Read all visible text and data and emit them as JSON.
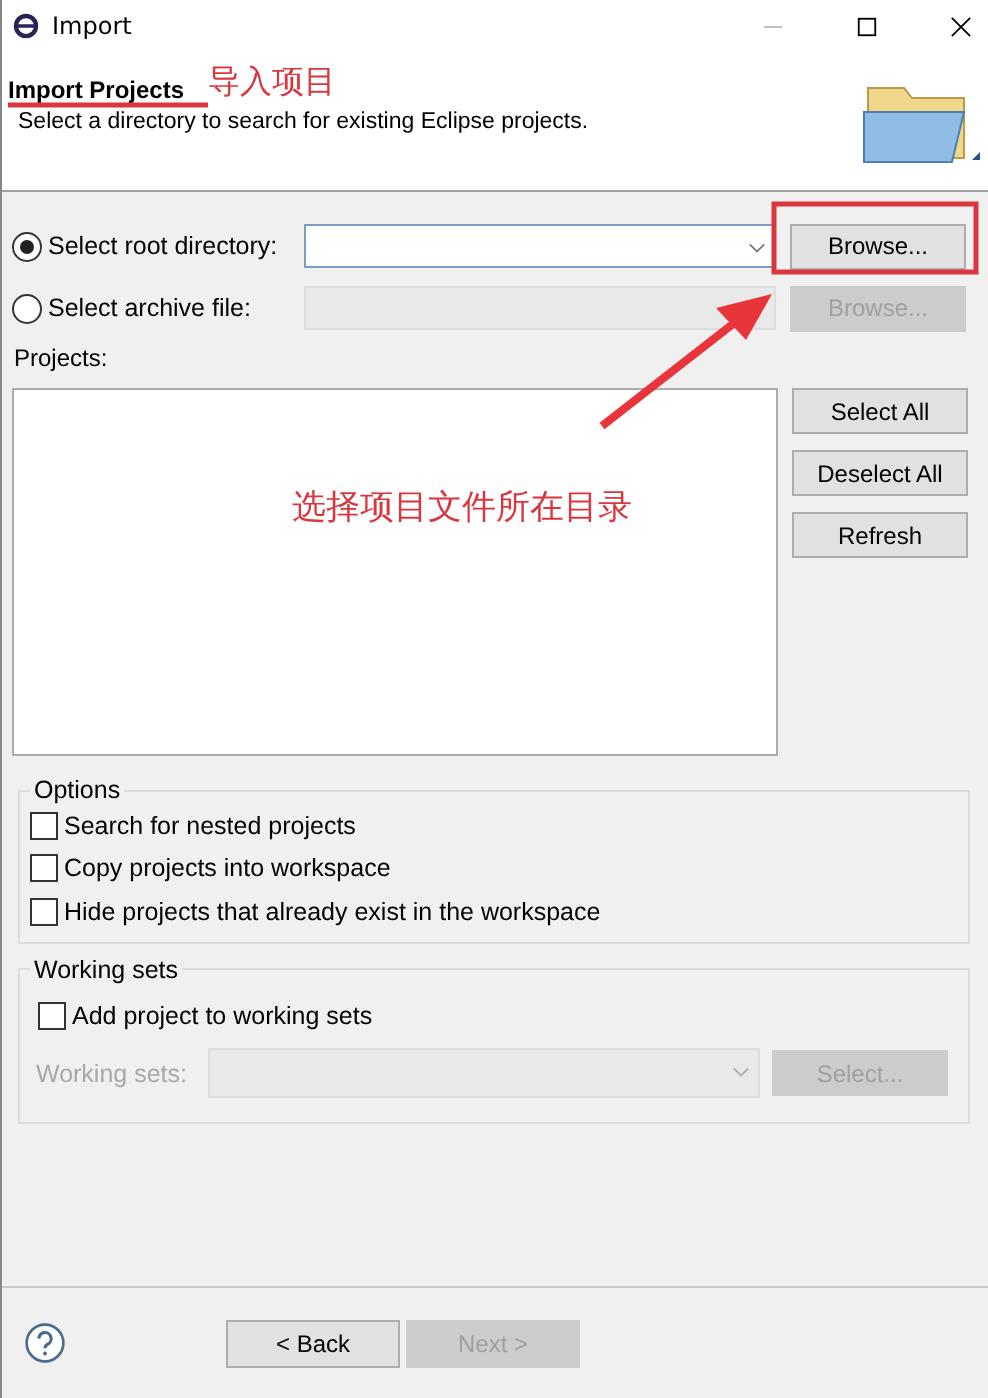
{
  "window": {
    "title": "Import"
  },
  "header": {
    "title": "Import Projects",
    "description": "Select a directory to search for existing Eclipse projects."
  },
  "sources": [
    {
      "label": "Select root directory:",
      "selected": true,
      "field_disabled": false,
      "button": "Browse...",
      "button_disabled": false
    },
    {
      "label": "Select archive file:",
      "selected": false,
      "field_disabled": true,
      "button": "Browse...",
      "button_disabled": true
    }
  ],
  "projects": {
    "label": "Projects:",
    "buttons": [
      {
        "label": "Select All",
        "disabled": false
      },
      {
        "label": "Deselect All",
        "disabled": false
      },
      {
        "label": "Refresh",
        "disabled": false
      }
    ]
  },
  "options": {
    "title": "Options",
    "items": [
      {
        "label": "Search for nested projects",
        "checked": false
      },
      {
        "label": "Copy projects into workspace",
        "checked": false
      },
      {
        "label": "Hide projects that already exist in the workspace",
        "checked": false
      }
    ]
  },
  "working_sets": {
    "title": "Working sets",
    "add": {
      "label": "Add project to working sets",
      "checked": false
    },
    "field_label": "Working sets:",
    "disabled": true,
    "button": "Select..."
  },
  "footer_buttons": [
    {
      "label": "< Back",
      "disabled": false
    },
    {
      "label": "Next >",
      "disabled": true
    }
  ],
  "annotations": [
    {
      "kind": "text",
      "text": "导入项目"
    },
    {
      "kind": "text",
      "text": "选择项目文件所在目录"
    }
  ]
}
